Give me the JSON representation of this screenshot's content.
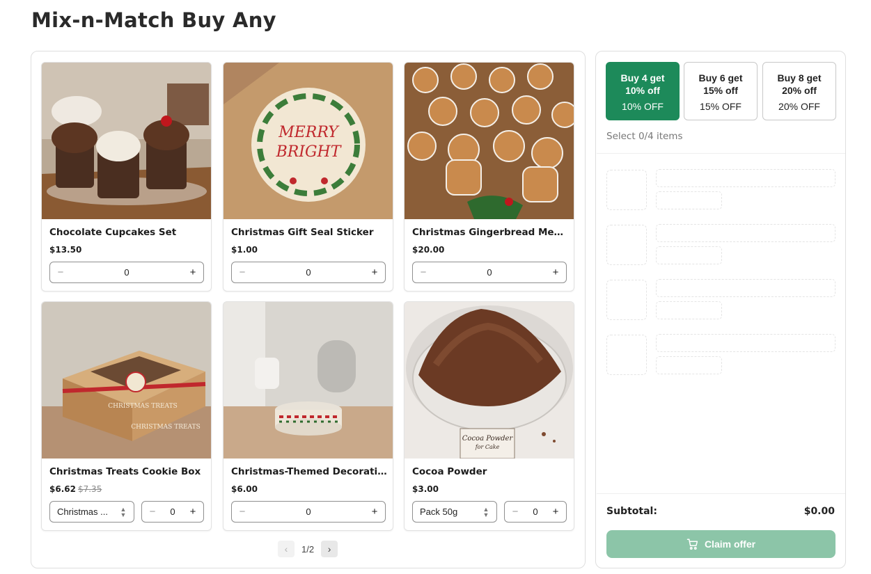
{
  "page": {
    "title": "Mix-n-Match Buy Any"
  },
  "products": [
    {
      "name": "Chocolate Cupcakes Set",
      "price": "$13.50",
      "qty": "0"
    },
    {
      "name": "Christmas Gift Seal Sticker",
      "price": "$1.00",
      "qty": "0"
    },
    {
      "name": "Christmas Gingerbread Men...",
      "price": "$20.00",
      "qty": "0"
    },
    {
      "name": "Christmas Treats Cookie Box",
      "price": "$6.62",
      "old_price": "$7.35",
      "variant": "Christmas ...",
      "qty": "0"
    },
    {
      "name": "Christmas-Themed Decorativ...",
      "price": "$6.00",
      "qty": "0"
    },
    {
      "name": "Cocoa Powder",
      "price": "$3.00",
      "variant": "Pack 50g",
      "qty": "0"
    }
  ],
  "image_text": {
    "sticker": [
      "MERRY",
      "BRIGHT"
    ],
    "cocoa_label": [
      "Cocoa Powder",
      "for Cake"
    ],
    "box": "CHRISTMAS TREATS"
  },
  "pagination": {
    "label": "1/2"
  },
  "tiers": [
    {
      "line1": "Buy 4 get",
      "line2": "10% off",
      "badge": "10% OFF",
      "active": true
    },
    {
      "line1": "Buy 6 get",
      "line2": "15% off",
      "badge": "15% OFF",
      "active": false
    },
    {
      "line1": "Buy 8 get",
      "line2": "20% off",
      "badge": "20% OFF",
      "active": false
    }
  ],
  "selection": {
    "status": "Select 0/4 items"
  },
  "summary": {
    "subtotal_label": "Subtotal:",
    "subtotal_value": "$0.00",
    "claim_label": "Claim offer"
  },
  "colors": {
    "accent": "#1d8a5a",
    "claim_disabled": "#8cc5a8"
  },
  "icons": [
    "minus-icon",
    "plus-icon",
    "chevron-updown-icon",
    "chevron-left-icon",
    "chevron-right-icon",
    "cart-icon"
  ]
}
